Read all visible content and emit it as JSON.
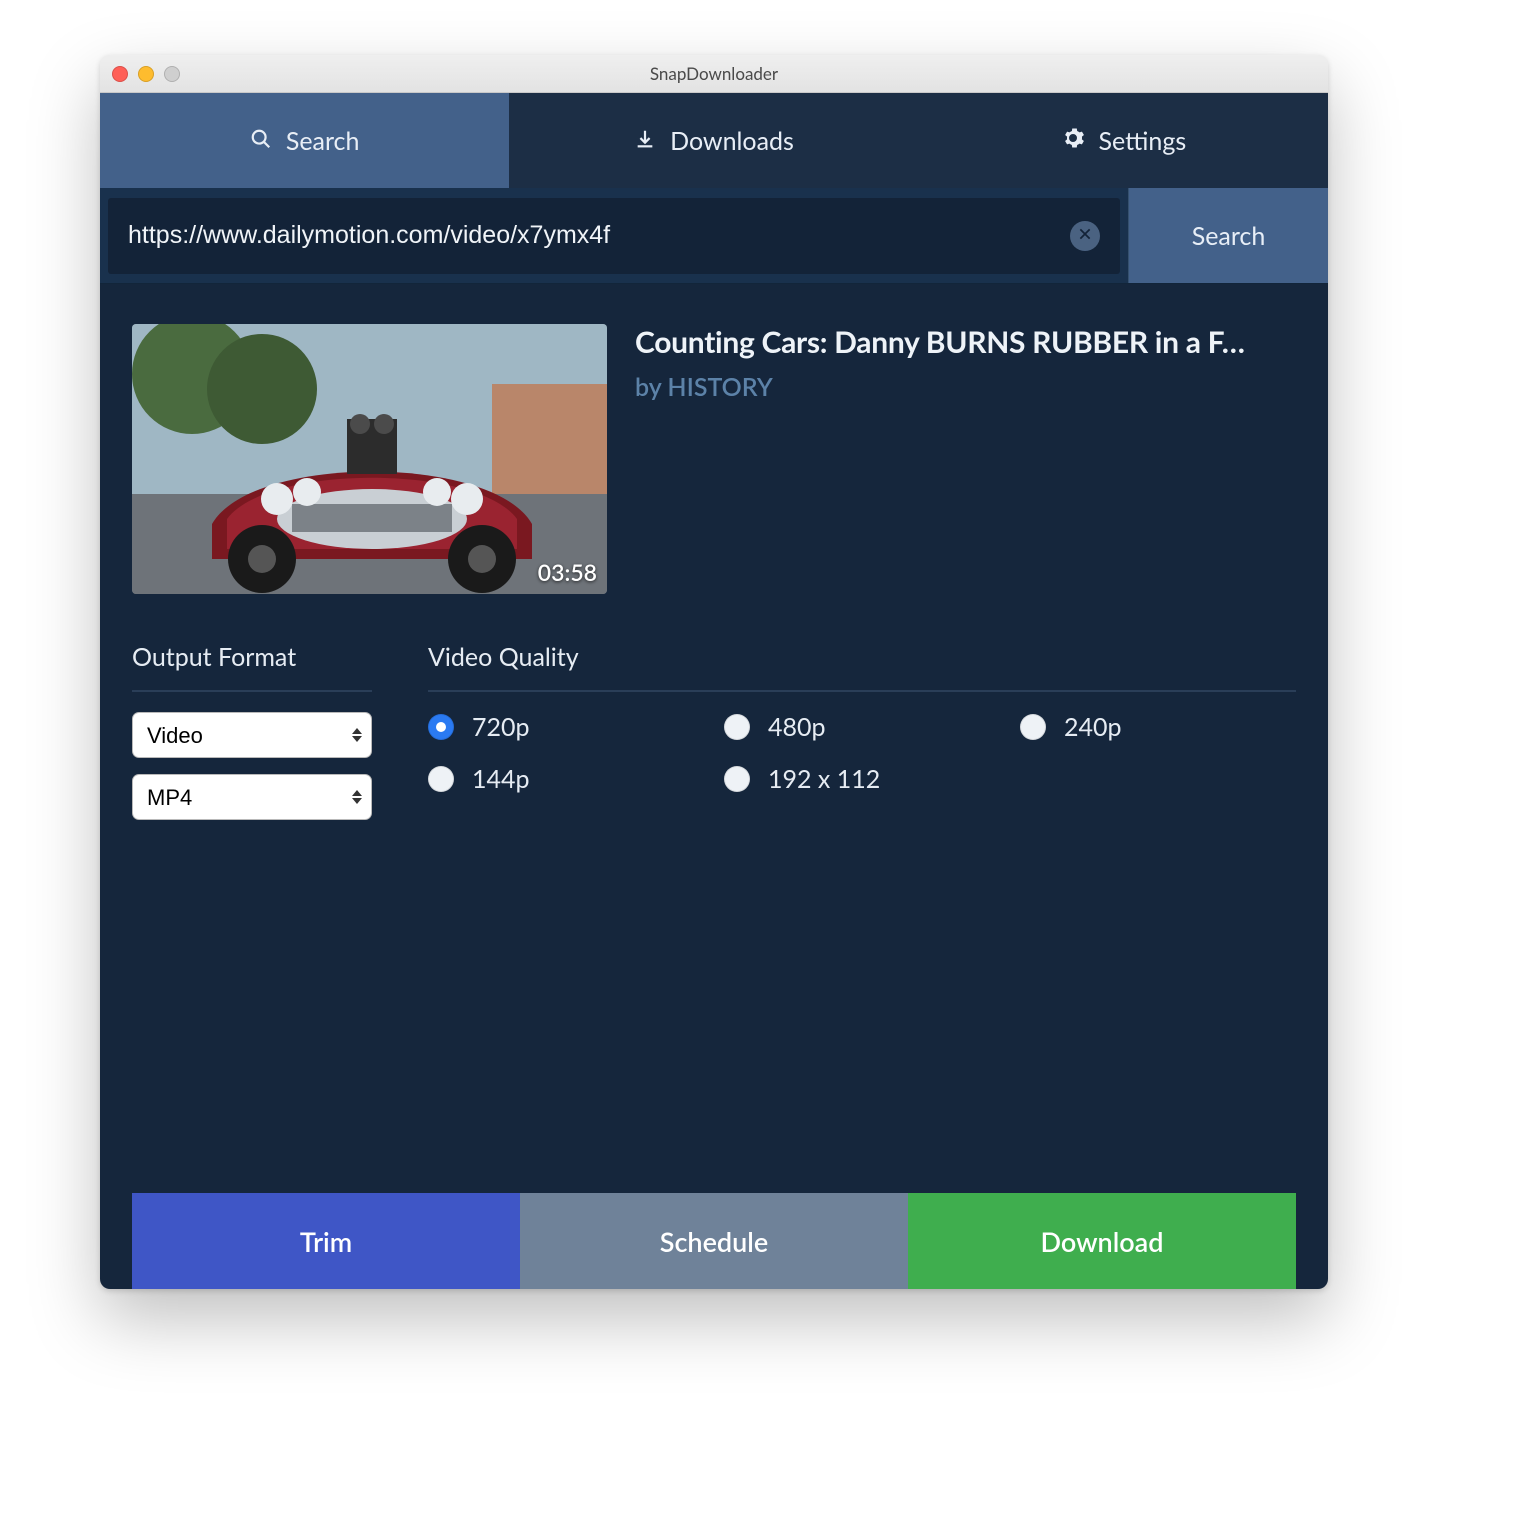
{
  "window": {
    "title": "SnapDownloader"
  },
  "tabs": {
    "search": "Search",
    "downloads": "Downloads",
    "settings": "Settings"
  },
  "search": {
    "url_value": "https://www.dailymotion.com/video/x7ymx4f",
    "go_label": "Search"
  },
  "video": {
    "title": "Counting Cars: Danny BURNS RUBBER in a F…",
    "by_prefix": "by ",
    "by_author": "HISTORY",
    "duration": "03:58"
  },
  "format": {
    "section_label": "Output Format",
    "type_value": "Video",
    "container_value": "MP4"
  },
  "quality": {
    "section_label": "Video Quality",
    "options": [
      "720p",
      "480p",
      "240p",
      "144p",
      "192 x 112"
    ],
    "selected": "720p"
  },
  "footer": {
    "trim": "Trim",
    "schedule": "Schedule",
    "download": "Download"
  }
}
